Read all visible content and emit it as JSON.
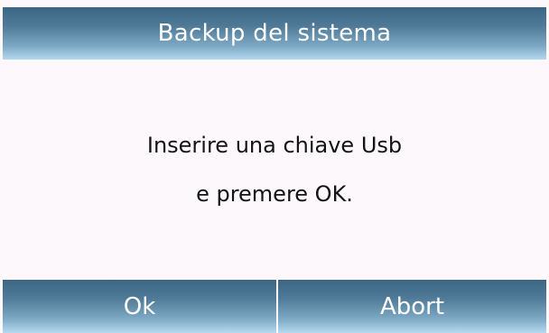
{
  "dialog": {
    "title": "Backup del sistema",
    "message_line1": "Inserire una chiave Usb",
    "message_line2": "e premere OK."
  },
  "buttons": {
    "ok_label": "Ok",
    "abort_label": "Abort"
  },
  "colors": {
    "header_dark": "#3c6684",
    "header_light": "#b3d8ee",
    "body_bg": "#fcf8fc",
    "text": "#141414"
  }
}
